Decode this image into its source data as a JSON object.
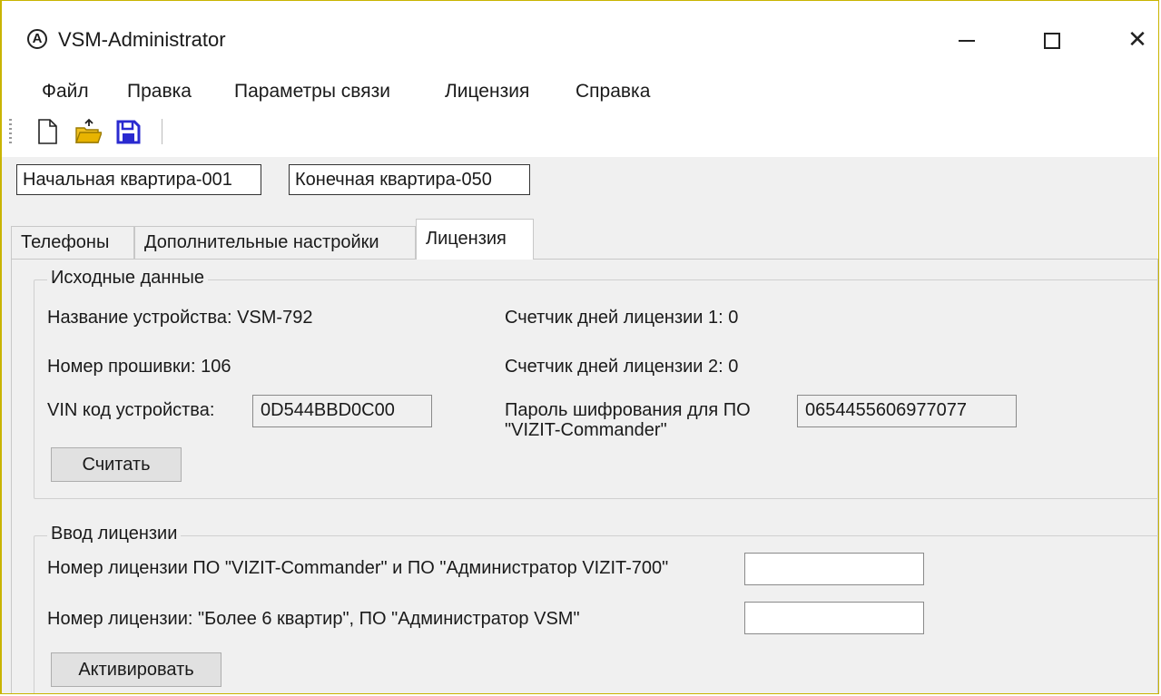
{
  "window": {
    "title": "VSM-Administrator",
    "icon_glyph": "A",
    "close_glyph": "✕"
  },
  "menu": [
    "Файл",
    "Правка",
    "Параметры связи",
    "Лицензия",
    "Справка"
  ],
  "toolbar": {
    "icons": [
      "new-document-icon",
      "open-folder-icon",
      "save-icon"
    ]
  },
  "range": {
    "start": "Начальная квартира-001",
    "end": "Конечная квартира-050"
  },
  "tabs": [
    {
      "label": "Телефоны",
      "active": false
    },
    {
      "label": "Дополнительные настройки",
      "active": false
    },
    {
      "label": "Лицензия",
      "active": true
    }
  ],
  "source_data": {
    "title": "Исходные данные",
    "device_name": "Название устройства: VSM-792",
    "firmware": "Номер прошивки: 106",
    "vin_label": "VIN код устройства:",
    "vin_value": "0D544BBD0C00",
    "counter1": "Счетчик дней лицензии 1: 0",
    "counter2": "Счетчик дней лицензии 2: 0",
    "password_label_1": "Пароль шифрования для ПО",
    "password_label_2": "\"VIZIT-Commander\"",
    "password_value": "0654455606977077",
    "read_button": "Считать"
  },
  "license_input": {
    "title": "Ввод лицензии",
    "license1_label": "Номер лицензии ПО \"VIZIT-Commander\" и ПО \"Администратор VIZIT-700\"",
    "license1_value": "",
    "license2_label": "Номер лицензии: \"Более 6 квартир\", ПО \"Администратор VSM\"",
    "license2_value": "",
    "activate_button": "Активировать"
  },
  "colors": {
    "window_border": "#c9b400",
    "panel": "#f0f0f0",
    "folder": "#e8b400",
    "save": "#2a2ad0"
  }
}
